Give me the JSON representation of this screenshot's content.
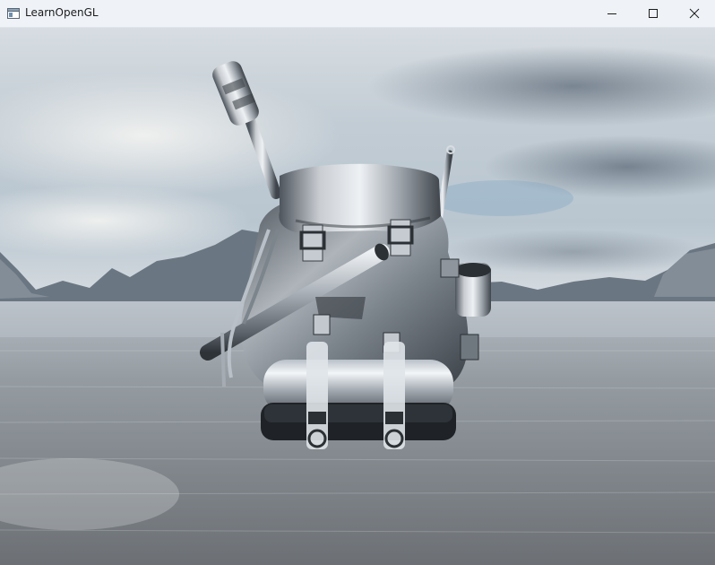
{
  "window": {
    "title": "LearnOpenGL",
    "icon": "app-window-icon",
    "controls": {
      "minimize": "minimize-icon",
      "maximize": "maximize-icon",
      "close": "close-icon"
    }
  },
  "scene": {
    "description_icon": "skybox-reflective-backpack",
    "colors": {
      "sky_top": "#c9d3dc",
      "sky_bottom": "#aeb7bf",
      "water": "#8a8f94",
      "metal": "#c8ccd2",
      "mountain": "#6c7682"
    }
  }
}
